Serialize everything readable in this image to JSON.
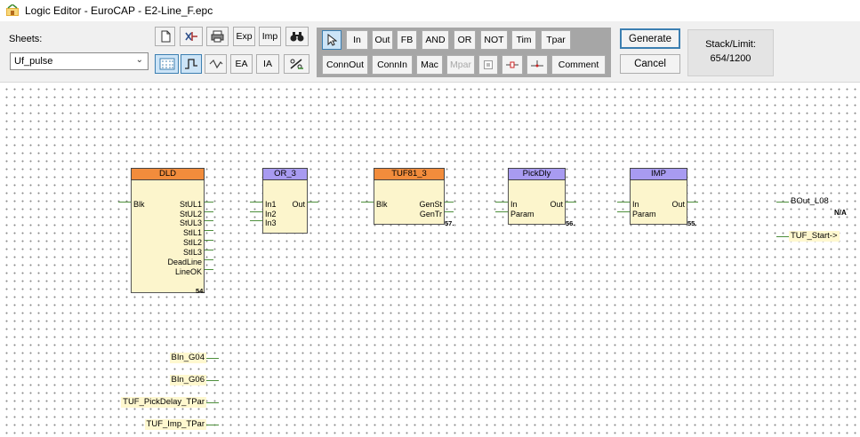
{
  "window": {
    "title": "Logic Editor - EuroCAP - E2-Line_F.epc"
  },
  "toolbar": {
    "sheets_label": "Sheets:",
    "sheet_value": "Uf_pulse",
    "text_buttons_top": [
      "Exp",
      "Imp"
    ],
    "text_buttons_bottom": [
      "EA",
      "IA"
    ],
    "gates_row1": [
      "In",
      "Out",
      "FB",
      "AND",
      "OR",
      "NOT",
      "Tim",
      "Tpar"
    ],
    "gates_row2": [
      "ConnOut",
      "ConnIn",
      "Mac",
      "Mpar",
      "Comment"
    ],
    "generate_label": "Generate",
    "cancel_label": "Cancel",
    "stack_label": "Stack/Limit:",
    "stack_value": "654/1200"
  },
  "blocks": {
    "dld": {
      "title": "DLD",
      "inputs": [
        "Blk"
      ],
      "outputs": [
        "StUL1",
        "StUL2",
        "StUL3",
        "StIL1",
        "StIL2",
        "StIL3",
        "DeadLine",
        "LineOK"
      ],
      "number": "54."
    },
    "or3": {
      "title": "OR_3",
      "inputs": [
        "In1",
        "In2",
        "In3"
      ],
      "outputs": [
        "Out"
      ]
    },
    "tuf81": {
      "title": "TUF81_3",
      "inputs": [
        "Blk"
      ],
      "outputs": [
        "GenSt",
        "GenTr"
      ],
      "number": "57."
    },
    "pickdly": {
      "title": "PickDly",
      "inputs": [
        "In",
        "Param"
      ],
      "outputs": [
        "Out"
      ],
      "number": "56."
    },
    "imp": {
      "title": "IMP",
      "inputs": [
        "In",
        "Param"
      ],
      "outputs": [
        "Out"
      ],
      "number": "55."
    }
  },
  "signals": {
    "bout": "BOut_L08",
    "bout_value": "N/A",
    "tuf_start": "TUF_Start->",
    "inputs": [
      "BIn_G04",
      "BIn_G06",
      "TUF_PickDelay_TPar",
      "TUF_Imp_TPar"
    ]
  },
  "colors": {
    "header_orange": "#f28c3c",
    "header_purple": "#a89bf1",
    "block_body": "#fcf5cc",
    "wire": "#4d8f3b",
    "toolbar_group": "#a6a6a6"
  }
}
